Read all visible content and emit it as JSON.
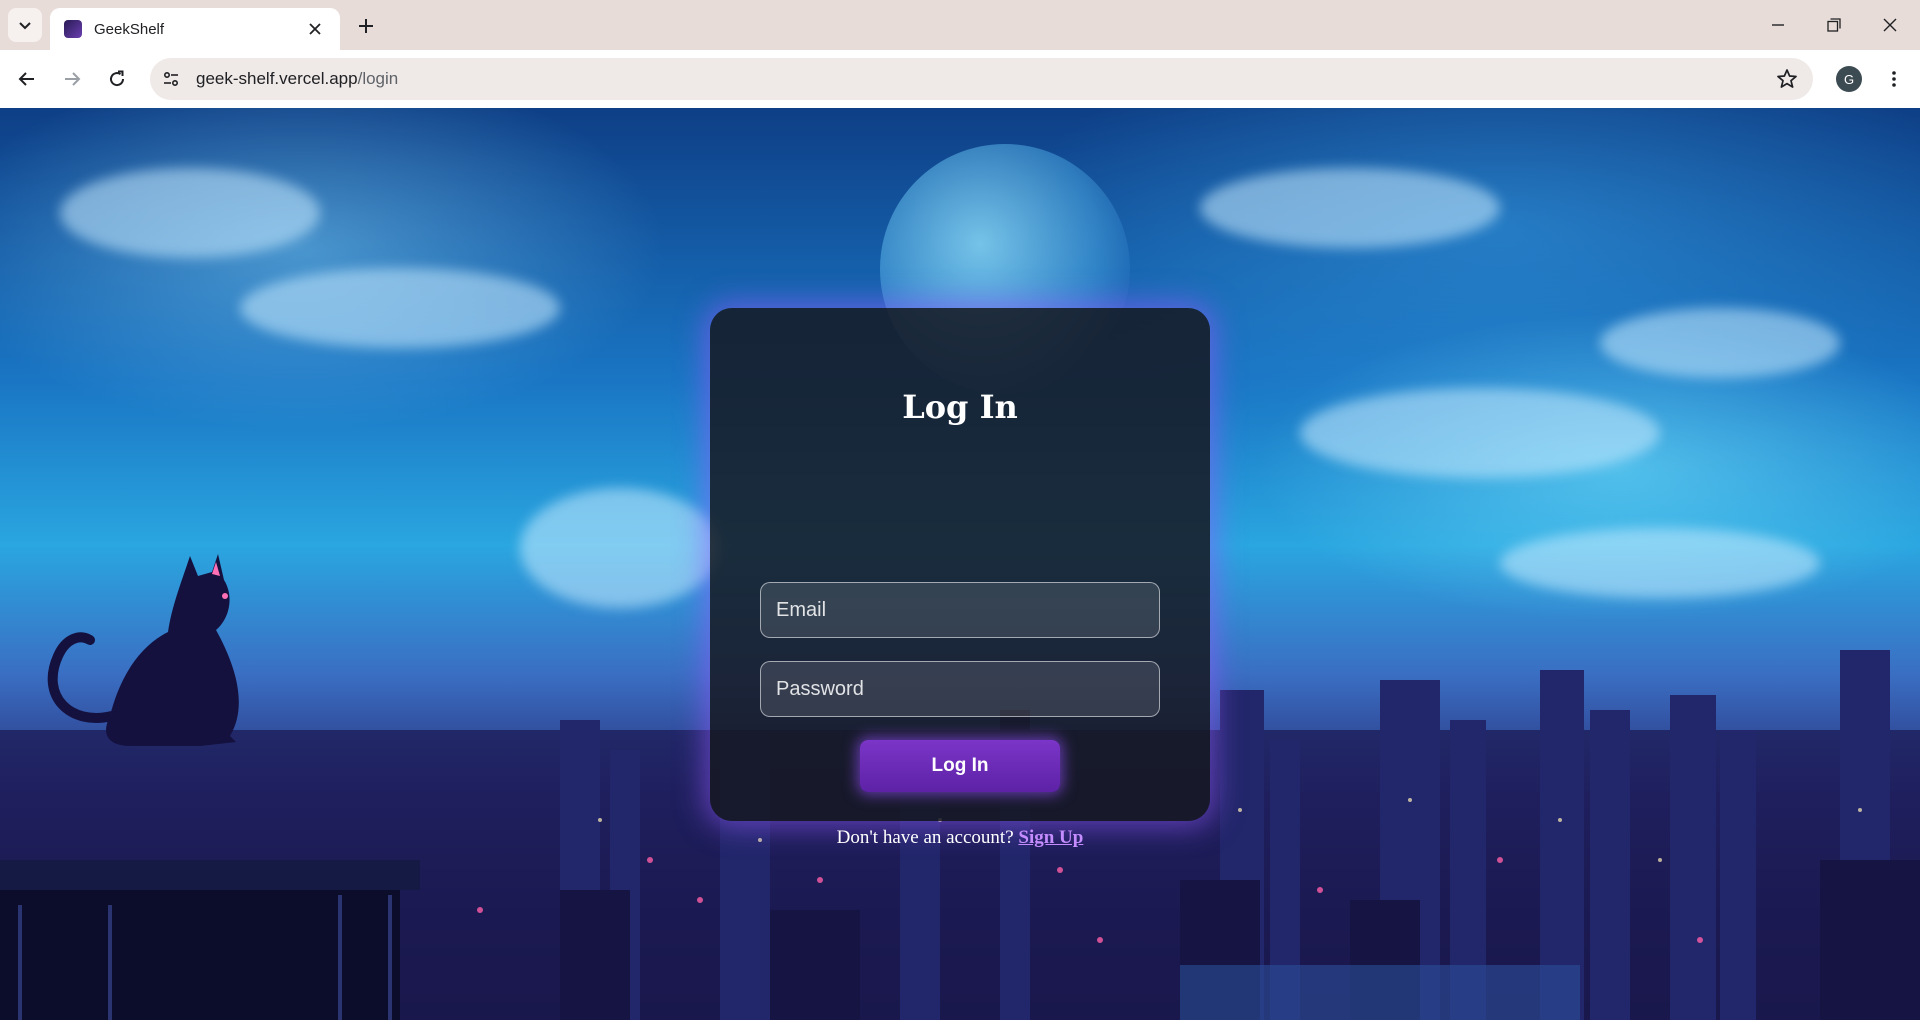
{
  "browser": {
    "tab": {
      "title": "GeekShelf",
      "close_label": "×"
    },
    "new_tab_label": "+",
    "url": {
      "host": "geek-shelf.vercel.app",
      "path": "/login"
    },
    "profile_initial": "G"
  },
  "login": {
    "title": "Log In",
    "email_placeholder": "Email",
    "password_placeholder": "Password",
    "submit_label": "Log In",
    "signup_prompt": "Don't have an account?",
    "signup_link": "Sign Up"
  },
  "colors": {
    "accent": "#6a2bb8",
    "link": "#c48cff",
    "card_bg": "#16182a"
  },
  "icons": [
    "tab-list-icon",
    "favicon-icon",
    "close-icon",
    "plus-icon",
    "minimize-icon",
    "restore-icon",
    "window-close-icon",
    "back-icon",
    "forward-icon",
    "reload-icon",
    "site-info-icon",
    "star-icon",
    "kebab-menu-icon"
  ]
}
